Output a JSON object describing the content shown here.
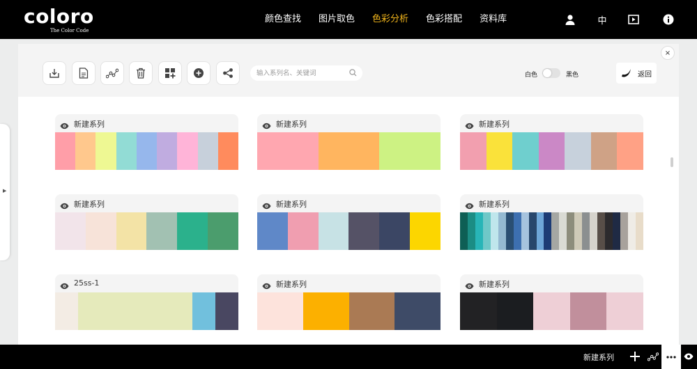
{
  "header": {
    "logo_text": "coloro",
    "tagline": "The Color Code",
    "nav": [
      {
        "label": "颜色查找",
        "active": false
      },
      {
        "label": "图片取色",
        "active": false
      },
      {
        "label": "色彩分析",
        "active": true
      },
      {
        "label": "色彩搭配",
        "active": false
      },
      {
        "label": "资料库",
        "active": false
      }
    ],
    "icons": [
      "user-icon",
      "language-icon",
      "video-icon",
      "info-icon"
    ],
    "language_label": "中",
    "active_color": "#f1b51c"
  },
  "toolbar": {
    "buttons": [
      "download-icon",
      "document-icon",
      "analysis-chart-icon",
      "trash-icon",
      "add-grid-icon",
      "add-circle-icon",
      "share-icon"
    ],
    "search_placeholder": "输入系列名、关键词",
    "search_value": "",
    "toggle_white_label": "白色",
    "toggle_black_label": "黑色",
    "return_label": "返回"
  },
  "close_label": "×",
  "palettes": [
    {
      "title": "新建系列",
      "colors": [
        "#ff9ea8",
        "#ffc88d",
        "#eef893",
        "#92dcd5",
        "#96b7ec",
        "#c0ace0",
        "#ffb4d8",
        "#c7d0db",
        "#ff8b5d"
      ]
    },
    {
      "title": "新建系列",
      "colors": [
        "#ffa7b0",
        "#ffb55f",
        "#cdf283"
      ]
    },
    {
      "title": "新建系列",
      "colors": [
        "#f29faf",
        "#fae23a",
        "#6fcfce",
        "#cb88c6",
        "#c7d1dc",
        "#cfa286",
        "#ffa185"
      ]
    },
    {
      "title": "新建系列",
      "colors": [
        "#f2e4ea",
        "#f7e3d9",
        "#f3e3a6",
        "#a2c1b2",
        "#2bb18c",
        "#4b9d6d"
      ]
    },
    {
      "title": "新建系列",
      "colors": [
        "#5f88c8",
        "#f09eb0",
        "#c7e2e5",
        "#555266",
        "#3b4664",
        "#fcd600"
      ]
    },
    {
      "title": "新建系列",
      "colors": [
        "#0e5f55",
        "#1b8d84",
        "#28b5b7",
        "#6fc8c8",
        "#bfe6ec",
        "#94b9d1",
        "#2a4e72",
        "#3d6fb0",
        "#a6c3de",
        "#27466c",
        "#6ea6d8",
        "#1c3b75",
        "#a5a7a3",
        "#dadbd4",
        "#8d8d7c",
        "#cfcab8",
        "#8b8f90",
        "#d6d3cc",
        "#584e48",
        "#2c2a2d",
        "#1f2a44",
        "#a8a29c",
        "#efece6",
        "#e8dcc9"
      ]
    },
    {
      "title": "25ss-1",
      "colors": [
        "#f3ece4",
        "#e5eabb",
        "#e5eabb",
        "#e5eabb",
        "#e5eabb",
        "#e5eabb",
        "#71c0dd",
        "#494761"
      ]
    },
    {
      "title": "新建系列",
      "colors": [
        "#fde3dc",
        "#fcb000",
        "#aa7a54",
        "#3e4b67"
      ]
    },
    {
      "title": "新建系列",
      "colors": [
        "#222224",
        "#1b1d20",
        "#eecfd6",
        "#c18f9c",
        "#eecfd6"
      ]
    }
  ],
  "bottombar": {
    "label": "新建系列",
    "icons": [
      "plus-icon",
      "analysis-chart-icon",
      "more-icon",
      "eye-icon"
    ]
  }
}
